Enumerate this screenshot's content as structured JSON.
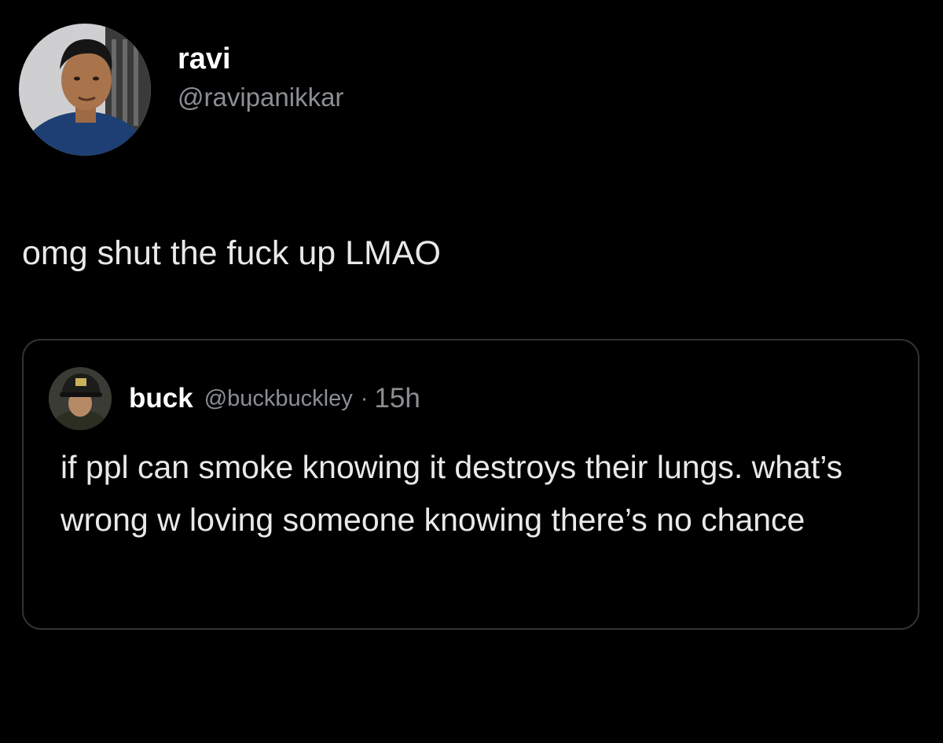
{
  "tweet": {
    "author": {
      "display_name": "ravi",
      "handle": "@ravipanikkar"
    },
    "text": "omg shut the fuck up LMAO",
    "quoted_tweet": {
      "author": {
        "display_name": "buck",
        "handle": "@buckbuckley"
      },
      "separator": "·",
      "time": "15h",
      "text": "if ppl can smoke knowing it destroys their lungs. what’s wrong w loving someone knowing there’s no chance"
    }
  },
  "colors": {
    "background": "#000000",
    "primary_text": "#e7e9ea",
    "secondary_text": "#8b8f94",
    "border": "#2f3336"
  }
}
